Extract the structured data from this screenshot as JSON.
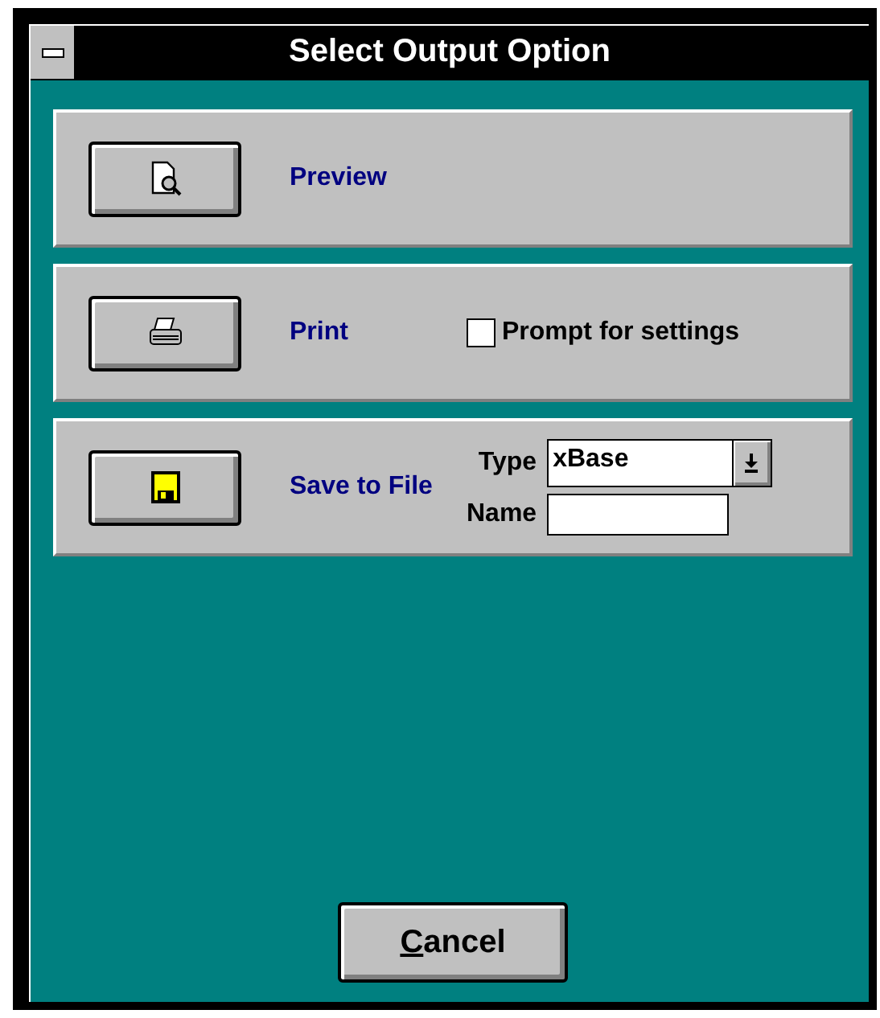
{
  "window": {
    "title": "Select Output Option"
  },
  "options": [
    {
      "kind": "preview",
      "label": "Preview"
    },
    {
      "kind": "print",
      "label": "Print",
      "checkbox": {
        "label": "Prompt for settings",
        "checked": false
      }
    },
    {
      "kind": "save",
      "label": "Save to File",
      "type_field": {
        "label": "Type",
        "value": "xBase"
      },
      "name_field": {
        "label": "Name"
      }
    }
  ],
  "cancel_button": {
    "label": "Cancel"
  }
}
